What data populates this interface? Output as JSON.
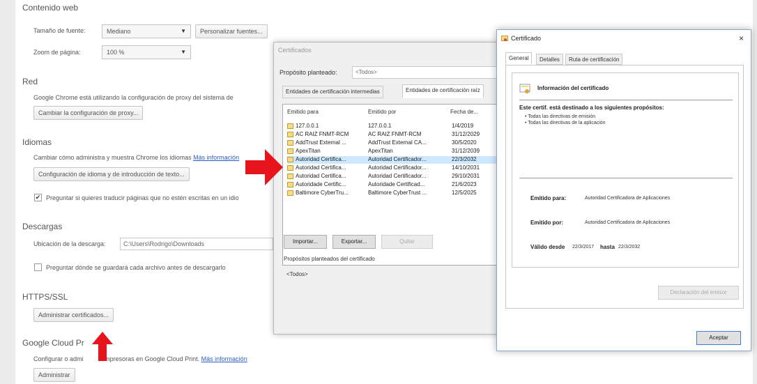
{
  "settings": {
    "top_heading": "Contenido web",
    "font_size_label": "Tamaño de fuente:",
    "font_size_value": "Mediano",
    "customize_fonts_button": "Personalizar fuentes...",
    "zoom_label": "Zoom de página:",
    "zoom_value": "100 %",
    "network_heading": "Red",
    "network_text": "Google Chrome está utilizando la configuración de proxy del sistema de",
    "proxy_button": "Cambiar la configuración de proxy...",
    "languages_heading": "Idiomas",
    "languages_text": "Cambiar cómo administra y muestra Chrome los idiomas",
    "languages_link": "Más información",
    "languages_button": "Configuración de idioma y de introducción de texto...",
    "translate_checkbox": "Preguntar si quieres traducir páginas que no estén escritas en un idio",
    "downloads_heading": "Descargas",
    "download_location_label": "Ubicación de la descarga:",
    "download_location_value": "C:\\Users\\Rodrigo\\Downloads",
    "ask_save_checkbox": "Preguntar dónde se guardará cada archivo antes de descargarlo",
    "https_heading": "HTTPS/SSL",
    "manage_certs_button": "Administrar certificados...",
    "cloud_print_heading": "Google Cloud Pr",
    "cloud_print_text": "Configurar o admi",
    "cloud_print_text2": "r impresoras en Google Cloud Print.",
    "cloud_print_link": "Más información",
    "manage_button": "Administrar"
  },
  "certs_dialog": {
    "title": "Certificados",
    "purpose_label": "Propósito planteado:",
    "purpose_value": "<Todos>",
    "tab_intermediate": "Entidades de certificación intermedias",
    "tab_root": "Entidades de certificación raíz",
    "col_issued_to": "Emitido para",
    "col_issued_by": "Emitido por",
    "col_date": "Fecha de...",
    "rows": [
      {
        "to": "127.0.0.1",
        "by": "127.0.0.1",
        "date": "1/4/2019"
      },
      {
        "to": "AC RAIZ FNMT-RCM",
        "by": "AC RAIZ FNMT-RCM",
        "date": "31/12/2029"
      },
      {
        "to": "AddTrust External ...",
        "by": "AddTrust External CA...",
        "date": "30/5/2020"
      },
      {
        "to": "ApexTitan",
        "by": "ApexTitan",
        "date": "31/12/2039"
      },
      {
        "to": "Autoridad Certifica...",
        "by": "Autoridad Certificador...",
        "date": "22/3/2032"
      },
      {
        "to": "Autoridad Certifica...",
        "by": "Autoridad Certificador...",
        "date": "14/10/2031"
      },
      {
        "to": "Autoridad Certifica...",
        "by": "Autoridad Certificador...",
        "date": "29/10/2031"
      },
      {
        "to": "Autoridade Certific...",
        "by": "Autoridade Certificad...",
        "date": "21/6/2023"
      },
      {
        "to": "Baltimore CyberTru...",
        "by": "Baltimore CyberTrust ...",
        "date": "12/5/2025"
      }
    ],
    "import_button": "Importar...",
    "export_button": "Exportar...",
    "remove_button": "Quitar",
    "purposes_label": "Propósitos planteados del certificado",
    "purposes_value": "<Todos>"
  },
  "cert_dialog": {
    "title": "Certificado",
    "close": "×",
    "tab_general": "General",
    "tab_details": "Detalles",
    "tab_path": "Ruta de certificación",
    "info_title": "Información del certificado",
    "purpose_heading": "Este certif. está destinado a los siguientes propósitos:",
    "purpose_1": "• Todas las directivas de emisión",
    "purpose_2": "• Todas las directivas de la aplicación",
    "issued_to_label": "Emitido para:",
    "issued_to_value": "Autoridad Certificadora de Aplicaciones",
    "issued_by_label": "Emitido por:",
    "issued_by_value": "Autoridad Certificadora de Aplicaciones",
    "valid_from_label": "Válido desde",
    "valid_from_value": "22/3/2017",
    "valid_to_label": "hasta",
    "valid_to_value": "22/3/2032",
    "issuer_statement_button": "Declaración del emisor",
    "accept_button": "Aceptar"
  },
  "colors": {
    "arrow": "#e8141b",
    "selection": "#cde8ff",
    "link": "#2c5ec5"
  }
}
